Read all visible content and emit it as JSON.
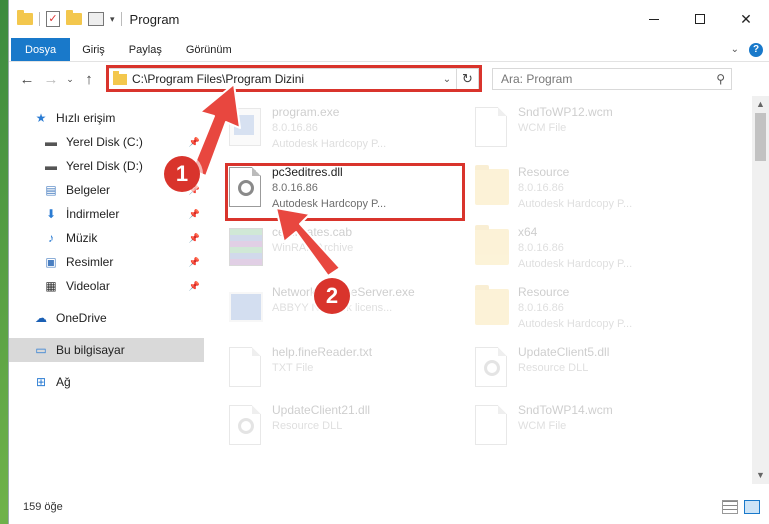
{
  "titlebar": {
    "title": "Program",
    "minimize": "—",
    "maximize": "□",
    "close": "✕"
  },
  "ribbon": {
    "tabs": [
      {
        "label": "Dosya",
        "active": true
      },
      {
        "label": "Giriş"
      },
      {
        "label": "Paylaş"
      },
      {
        "label": "Görünüm"
      }
    ],
    "help": "?"
  },
  "address": {
    "path": "C:\\Program Files\\Program Dizini",
    "search_placeholder": "Ara: Program"
  },
  "nav": {
    "items": [
      {
        "label": "Hızlı erişim",
        "icon": "star-icon"
      },
      {
        "label": "Yerel Disk (C:)",
        "icon": "drive-icon",
        "pinned": true
      },
      {
        "label": "Yerel Disk (D:)",
        "icon": "drive-icon",
        "pinned": true
      },
      {
        "label": "Belgeler",
        "icon": "documents-icon",
        "pinned": true
      },
      {
        "label": "İndirmeler",
        "icon": "download-icon",
        "pinned": true
      },
      {
        "label": "Müzik",
        "icon": "music-icon",
        "pinned": true
      },
      {
        "label": "Resimler",
        "icon": "pictures-icon",
        "pinned": true
      },
      {
        "label": "Videolar",
        "icon": "video-icon",
        "pinned": true
      },
      {
        "label": "OneDrive",
        "icon": "cloud-icon"
      },
      {
        "label": "Bu bilgisayar",
        "icon": "computer-icon",
        "selected": true
      },
      {
        "label": "Ağ",
        "icon": "network-icon"
      }
    ]
  },
  "files": [
    {
      "name": "program.exe",
      "line2": "8.0.16.86",
      "line3": "Autodesk Hardcopy P...",
      "icon": "exe",
      "faded": true
    },
    {
      "name": "SndToWP12.wcm",
      "line2": "WCM File",
      "line3": "",
      "icon": "doc",
      "faded": true
    },
    {
      "name": "pc3editres.dll",
      "line2": "8.0.16.86",
      "line3": "Autodesk Hardcopy P...",
      "icon": "dll",
      "faded": false
    },
    {
      "name": "Resource",
      "line2": "8.0.16.86",
      "line3": "Autodesk Hardcopy P...",
      "icon": "folder",
      "faded": true
    },
    {
      "name": "certificates.cab",
      "line2": "WinRAR Archive",
      "line3": "",
      "icon": "rar",
      "faded": true
    },
    {
      "name": "x64",
      "line2": "8.0.16.86",
      "line3": "Autodesk Hardcopy P...",
      "icon": "folder",
      "faded": true
    },
    {
      "name": "NetworkLicenseServer.exe",
      "line2": "ABBYY Network licens...",
      "line3": "",
      "icon": "win",
      "faded": true
    },
    {
      "name": "Resource",
      "line2": "8.0.16.86",
      "line3": "Autodesk Hardcopy P...",
      "icon": "folder",
      "faded": true
    },
    {
      "name": "help.fineReader.txt",
      "line2": "TXT File",
      "line3": "",
      "icon": "doc",
      "faded": true
    },
    {
      "name": "UpdateClient5.dll",
      "line2": "Resource DLL",
      "line3": "",
      "icon": "dll",
      "faded": true
    },
    {
      "name": "UpdateClient21.dll",
      "line2": "Resource DLL",
      "line3": "",
      "icon": "dll",
      "faded": true
    },
    {
      "name": "SndToWP14.wcm",
      "line2": "WCM File",
      "line3": "",
      "icon": "doc",
      "faded": true
    }
  ],
  "status": {
    "count": "159 öğe"
  },
  "annotations": {
    "badge1": "1",
    "badge2": "2"
  }
}
